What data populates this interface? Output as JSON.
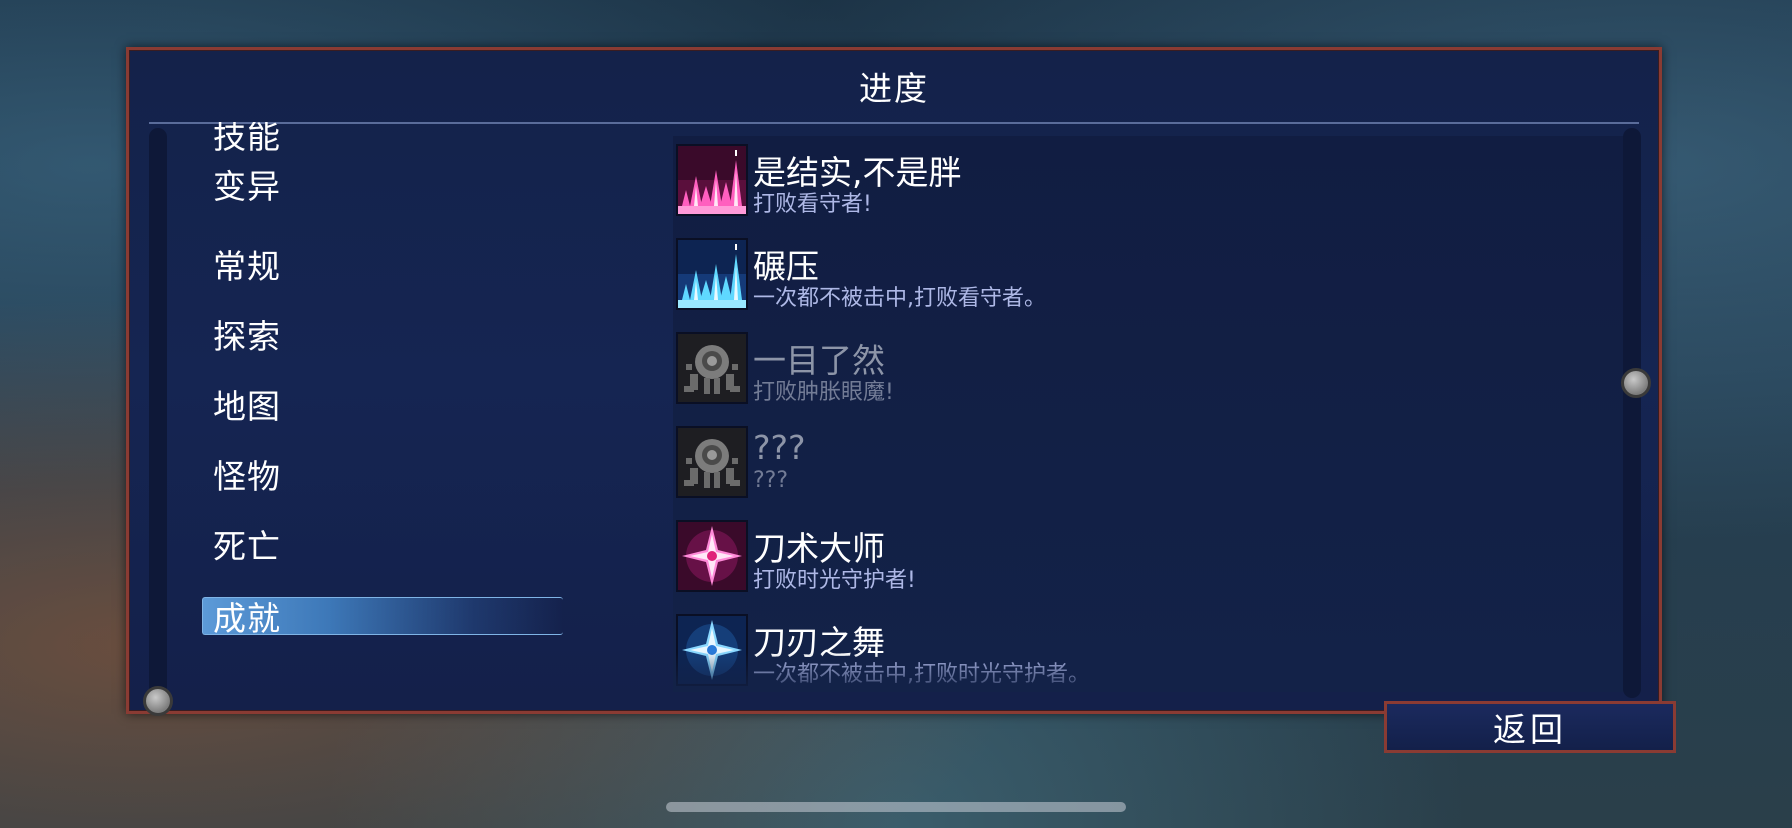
{
  "window": {
    "title": "进度"
  },
  "categories": [
    {
      "label": "技能",
      "selected": false
    },
    {
      "label": "变异",
      "selected": false
    },
    {
      "label": "常规",
      "selected": false
    },
    {
      "label": "探索",
      "selected": false
    },
    {
      "label": "地图",
      "selected": false
    },
    {
      "label": "怪物",
      "selected": false
    },
    {
      "label": "死亡",
      "selected": false
    },
    {
      "label": "成就",
      "selected": true
    }
  ],
  "achievements": [
    {
      "title": "是结实,不是胖",
      "description": "打败看守者!",
      "unlocked": true,
      "icon": "pink-spikes-icon"
    },
    {
      "title": "碾压",
      "description": "一次都不被击中,打败看守者。",
      "unlocked": true,
      "icon": "blue-spikes-icon"
    },
    {
      "title": "一目了然",
      "description": "打败肿胀眼魔!",
      "unlocked": false,
      "icon": "eye-monster-icon"
    },
    {
      "title": "???",
      "description": "???",
      "unlocked": false,
      "icon": "eye-monster-icon"
    },
    {
      "title": "刀术大师",
      "description": "打败时光守护者!",
      "unlocked": true,
      "icon": "pink-shuriken-icon"
    },
    {
      "title": "刀刃之舞",
      "description": "一次都不被击中,打败时光守护者。",
      "unlocked": true,
      "icon": "blue-shuriken-icon"
    }
  ],
  "footer": {
    "back_label": "返回"
  },
  "colors": {
    "frame": "#8a3b33",
    "panel": "#14224a",
    "selected": "#4a8ed0"
  }
}
